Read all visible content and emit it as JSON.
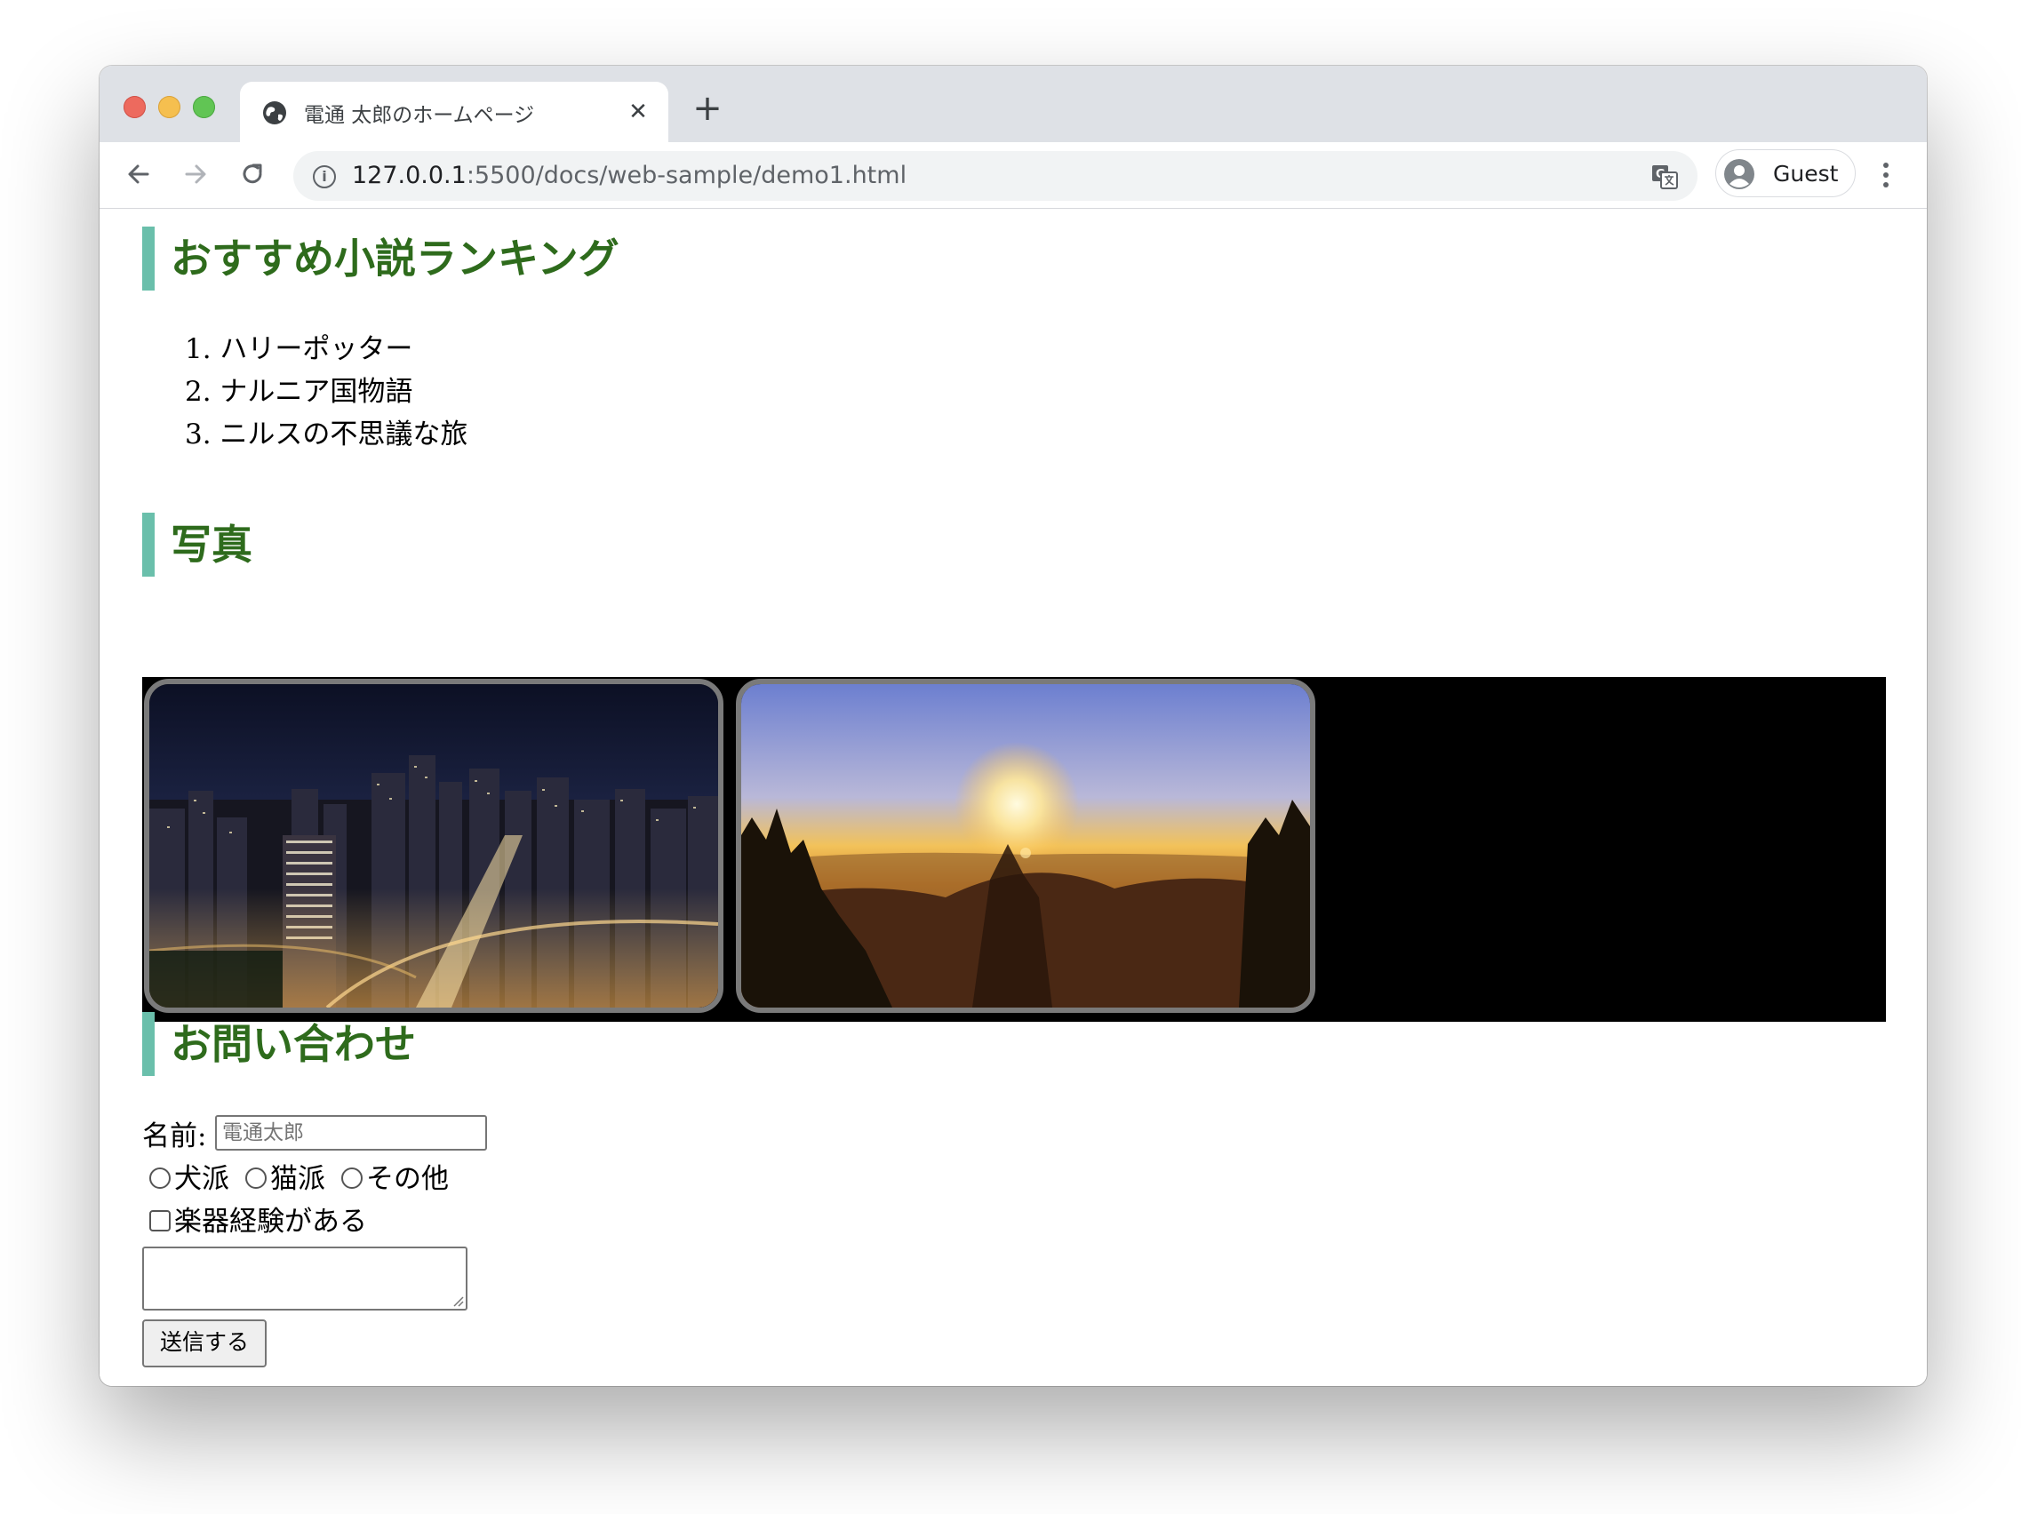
{
  "browser": {
    "tab": {
      "title": "電通 太郎のホームページ",
      "icon": "globe-icon",
      "close_glyph": "✕"
    },
    "new_tab_glyph": "+",
    "address_bar": {
      "host": "127.0.0.1",
      "path": ":5500/docs/web-sample/demo1.html"
    },
    "profile": {
      "label": "Guest",
      "icon": "avatar-icon"
    },
    "colors": {
      "tab_strip": "#dee1e6",
      "close": "#ed6a5e",
      "minimize": "#f5bf4f",
      "maximize": "#61c554"
    }
  },
  "page": {
    "colors": {
      "heading_text": "#2e6b1c",
      "heading_bar": "#6abfab",
      "gallery_background": "#000000"
    },
    "ranking": {
      "heading": "おすすめ小説ランキング",
      "items": [
        "1. ハリーポッター",
        "2. ナルニア国物語",
        "3. ニルスの不思議な旅"
      ]
    },
    "photos": {
      "heading": "写真",
      "images": [
        "city-night-view-image",
        "sunrise-mountain-image"
      ]
    },
    "contact": {
      "heading": "お問い合わせ",
      "name_label": "名前:",
      "name_placeholder": "電通太郎",
      "name_value": "",
      "pet_options": [
        "犬派",
        "猫派",
        "その他"
      ],
      "instrument_label": "楽器経験がある",
      "message_value": "",
      "submit_label": "送信する"
    }
  }
}
